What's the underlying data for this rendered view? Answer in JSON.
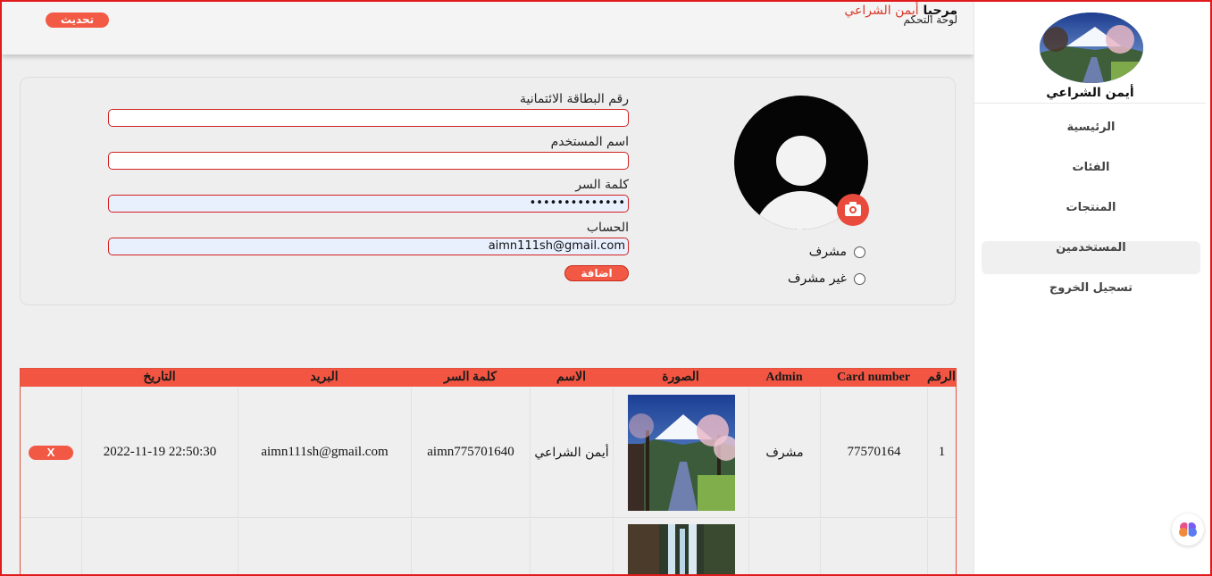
{
  "header": {
    "refresh_label": "تحديث",
    "welcome_prefix": "مرحبا",
    "welcome_name": "أيمن الشراعي",
    "dashboard_label": "لوحة التحكم"
  },
  "sidebar": {
    "user_name": "أيمن الشراعي",
    "items": [
      {
        "label": "الرئيسية"
      },
      {
        "label": "الفئات"
      },
      {
        "label": "المنتجات"
      },
      {
        "label": "المستخدمين",
        "active": true
      },
      {
        "label": "تسجيل الخروج"
      }
    ]
  },
  "form": {
    "card_label": "رقم البطاقة الائتمانية",
    "card_value": "",
    "username_label": "اسم المستخدم",
    "username_value": "",
    "password_label": "كلمة السر",
    "password_mask": "••••••••••••••",
    "account_label": "الحساب",
    "account_value": "aimn111sh@gmail.com",
    "add_label": "اضافة",
    "radio_admin": "مشرف",
    "radio_not_admin": "غير مشرف"
  },
  "table": {
    "headers": {
      "num": "الرقم",
      "card": "Card number",
      "admin": "Admin",
      "image": "الصورة",
      "name": "الاسم",
      "password": "كلمة السر",
      "email": "البريد",
      "date": "التاريخ"
    },
    "rows": [
      {
        "num": "1",
        "card": "77570164",
        "admin": "مشرف",
        "name": "أيمن الشراعي",
        "password": "aimn775701640",
        "email": "aimn111sh@gmail.com",
        "date": "2022-11-19 22:50:30",
        "delete": "X"
      }
    ]
  },
  "colors": {
    "accent": "#f25542",
    "border_red": "#e01b1b",
    "sidebar_bg": "#ffffff",
    "main_bg": "#efefef"
  }
}
